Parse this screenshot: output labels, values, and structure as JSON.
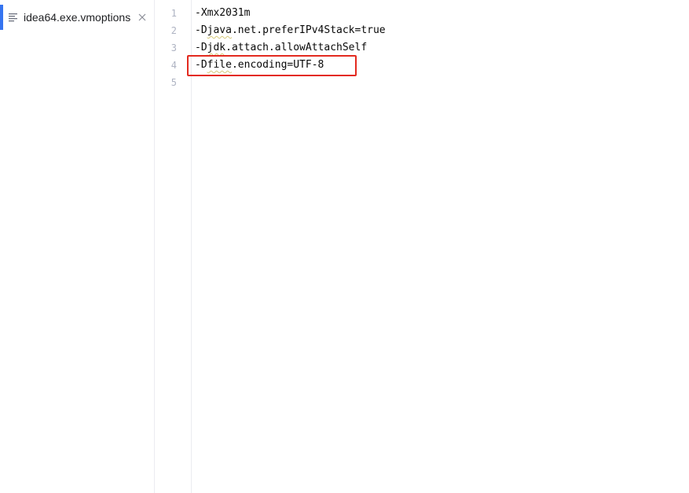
{
  "tab": {
    "label": "idea64.exe.vmoptions",
    "icon": "text-file-icon",
    "close_icon": "close-icon",
    "active": true,
    "accent_color": "#3574f0"
  },
  "editor": {
    "line_numbers": [
      "1",
      "2",
      "3",
      "4",
      "5"
    ],
    "lines": [
      {
        "prefix": "-Xmx2031m",
        "squiggle": "",
        "suffix": ""
      },
      {
        "prefix": "-D",
        "squiggle": "java",
        "suffix": ".net.preferIPv4Stack=true"
      },
      {
        "prefix": "-D",
        "squiggle": "jdk",
        "suffix": ".attach.allowAttachSelf"
      },
      {
        "prefix": "-D",
        "squiggle": "file",
        "suffix": ".encoding=UTF-8"
      },
      {
        "prefix": "",
        "squiggle": "",
        "suffix": ""
      }
    ],
    "highlighted_line": "4",
    "highlight_color": "#e32a1f"
  }
}
